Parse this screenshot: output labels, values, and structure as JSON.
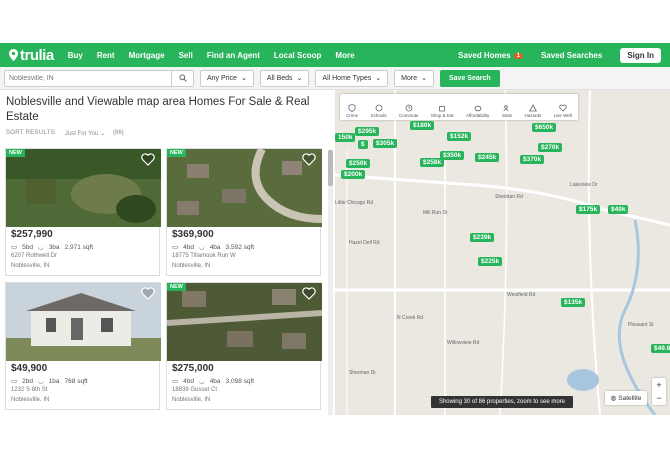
{
  "nav": {
    "logo": "trulia",
    "links": [
      "Buy",
      "Rent",
      "Mortgage",
      "Sell",
      "Find an Agent",
      "Local Scoop",
      "More"
    ],
    "saved_homes": "Saved Homes",
    "saved_homes_count": "1",
    "saved_searches": "Saved Searches",
    "sign_in": "Sign In"
  },
  "filters": {
    "search_placeholder": "Noblesville, IN",
    "price": "Any Price",
    "beds": "All Beds",
    "home_types": "All Home Types",
    "more": "More",
    "save": "Save Search"
  },
  "results": {
    "title": "Noblesville and Viewable map area Homes For Sale & Real Estate",
    "sort_label": "SORT RESULTS:",
    "sort_value": "Just For You",
    "count": "(86)"
  },
  "listings": [
    {
      "badge": "NEW",
      "price": "$257,990",
      "bd": "5bd",
      "ba": "3ba",
      "sqft": "2,971 sqft",
      "address": "6207 Rothwell Dr",
      "city": "Noblesville, IN"
    },
    {
      "badge": "NEW",
      "price": "$369,900",
      "bd": "4bd",
      "ba": "4ba",
      "sqft": "3,592 sqft",
      "address": "18775 Tillamook Run W",
      "city": "Noblesville, IN"
    },
    {
      "badge": "",
      "price": "$49,900",
      "bd": "2bd",
      "ba": "1ba",
      "sqft": "768 sqft",
      "address": "1232 S 8th St",
      "city": "Noblesville, IN"
    },
    {
      "badge": "NEW",
      "price": "$275,000",
      "bd": "4bd",
      "ba": "4ba",
      "sqft": "3,098 sqft",
      "address": "18839 Gusset Ct",
      "city": "Noblesville, IN"
    }
  ],
  "map": {
    "tools": [
      "Crime",
      "Schools",
      "Commute",
      "Shop & Eat",
      "Affordability",
      "Stats",
      "Hazards",
      "Live Well"
    ],
    "pins": [
      "150k",
      "$295k",
      "$",
      "$305k",
      "$180k",
      "$152k",
      "$650k",
      "$270k",
      "$250k",
      "$258k",
      "$350k",
      "$245k",
      "$370k",
      "$200k",
      "$175k",
      "$40k",
      "$239k",
      "$225k",
      "$135k",
      "$49.9"
    ],
    "roads": [
      "Sheridan Rd",
      "Westfield Rd",
      "Mill Run Dr",
      "Hazel Dell Rd",
      "N Creek Rd",
      "Willowview Rd",
      "Sherman Dr",
      "Little Chicago Rd",
      "Lakeview Dr",
      "Pleasant St"
    ],
    "status": "Showing 30 of 86 properties, zoom to see more",
    "satellite": "Satellite",
    "zoom_in": "+",
    "zoom_out": "−"
  }
}
